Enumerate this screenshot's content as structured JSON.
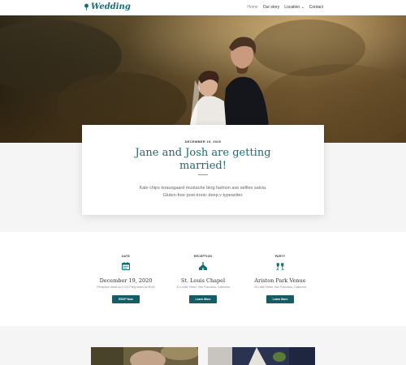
{
  "header": {
    "logo_text": "Wedding",
    "nav": [
      "Home",
      "Our story",
      "Location",
      "Contact"
    ],
    "location_caret": "⌄"
  },
  "hero_card": {
    "date": "DECEMBER 19, 2020",
    "title_line1": "Jane and Josh are getting",
    "title_line2": "married!",
    "text_line1": "Kale chips knausgaard mustache blog fashion axe selfies salvia.",
    "text_line2": "Gluten-free post-ironic deep v typewriter."
  },
  "events": [
    {
      "caption": "DATE",
      "icon": "calendar-icon",
      "title": "December 19, 2020",
      "detail": "Reception starts at 17:00 Party starts at 08:00",
      "button": "RSVP Now"
    },
    {
      "caption": "RECEPTION",
      "icon": "chapel-icon",
      "title": "St. Louis Chapel",
      "detail": "31 Locke Street, San Francisco, California",
      "button": "Learn More"
    },
    {
      "caption": "PARTY",
      "icon": "glasses-icon",
      "title": "Ariston Park Venue",
      "detail": "29 Lake Street, San Francisco, California",
      "button": "Learn More"
    }
  ],
  "colors": {
    "accent": "#1b6b73",
    "button": "#155c64",
    "band": "#f5f5f6"
  }
}
